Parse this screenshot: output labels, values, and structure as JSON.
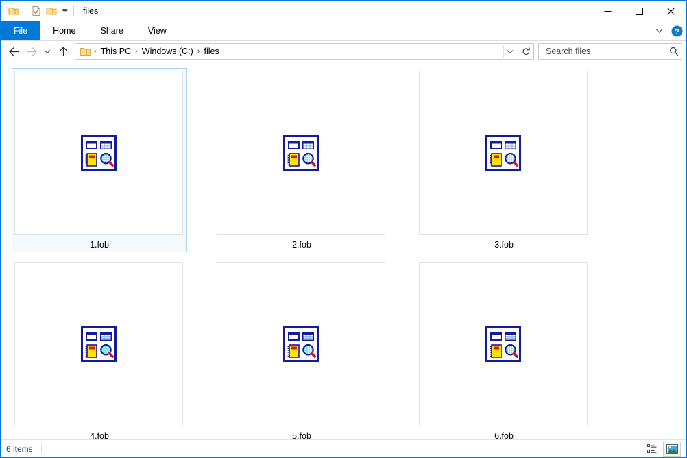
{
  "window": {
    "title": "files",
    "quick_access": [
      {
        "name": "folder-icon",
        "label": "Folder"
      },
      {
        "name": "properties-icon",
        "label": "Properties"
      },
      {
        "name": "new-folder-icon",
        "label": "New folder"
      }
    ],
    "controls": {
      "minimize": "─",
      "maximize": "☐",
      "close": "✕"
    }
  },
  "ribbon": {
    "tabs": [
      {
        "label": "File",
        "active": true
      },
      {
        "label": "Home",
        "active": false
      },
      {
        "label": "Share",
        "active": false
      },
      {
        "label": "View",
        "active": false
      }
    ],
    "expand_icon": "chevron-down-icon",
    "help_icon": "help-icon",
    "help_label": "?"
  },
  "address": {
    "back_label": "←",
    "forward_label": "→",
    "recent_label": "⌄",
    "up_label": "↑",
    "breadcrumbs": [
      "This PC",
      "Windows (C:)",
      "files"
    ],
    "separator": "›",
    "dropdown_label": "⌄",
    "refresh_label": "↻"
  },
  "search": {
    "placeholder": "Search files",
    "value": "",
    "icon": "search-icon"
  },
  "files": [
    {
      "name": "1.fob",
      "icon": "fob-file-icon",
      "selected": true
    },
    {
      "name": "2.fob",
      "icon": "fob-file-icon",
      "selected": false
    },
    {
      "name": "3.fob",
      "icon": "fob-file-icon",
      "selected": false
    },
    {
      "name": "4.fob",
      "icon": "fob-file-icon",
      "selected": false
    },
    {
      "name": "5.fob",
      "icon": "fob-file-icon",
      "selected": false
    },
    {
      "name": "6.fob",
      "icon": "fob-file-icon",
      "selected": false
    }
  ],
  "status": {
    "items_text": "6 items",
    "views": [
      {
        "name": "details-view-button",
        "active": false
      },
      {
        "name": "large-icons-view-button",
        "active": true
      }
    ]
  },
  "colors": {
    "accent": "#0078d7",
    "selection_border": "#a9d3ef",
    "selection_fill": "#f3f9fd",
    "icon_navy": "#161a9e",
    "icon_yellow": "#ffe400",
    "icon_red": "#e81123",
    "icon_cyan": "#7fe3e3",
    "status_text": "#1b3e6f"
  }
}
